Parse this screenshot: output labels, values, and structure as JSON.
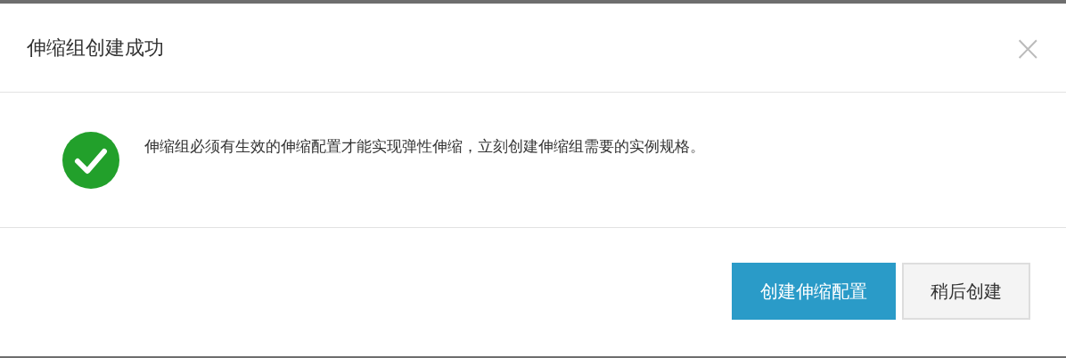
{
  "dialog": {
    "title": "伸缩组创建成功",
    "close_label": "×",
    "message": "伸缩组必须有生效的伸缩配置才能实现弹性伸缩，立刻创建伸缩组需要的实例规格。",
    "icon": {
      "kind": "success"
    },
    "buttons": [
      {
        "label": "创建伸缩配置",
        "kind": "primary"
      },
      {
        "label": "稍后创建",
        "kind": "secondary"
      }
    ]
  }
}
